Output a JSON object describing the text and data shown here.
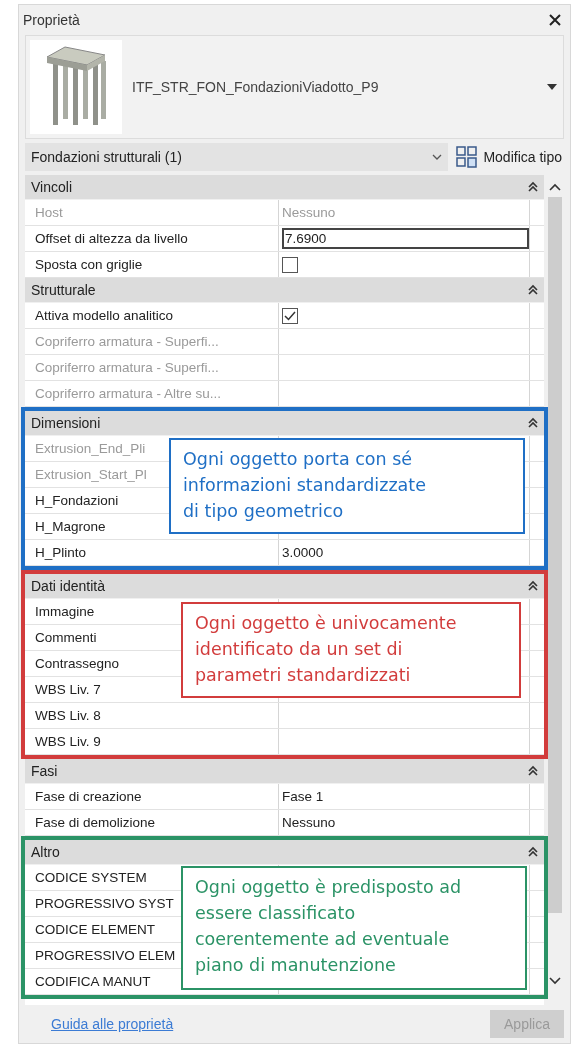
{
  "panel": {
    "title": "Proprietà"
  },
  "type_selector": {
    "name": "ITF_STR_FON_FondazioniViadotto_P9"
  },
  "filter": {
    "value": "Fondazioni strutturali (1)",
    "edit_type_button": "Modifica tipo"
  },
  "sections": [
    {
      "title": "Vincoli",
      "rows": [
        {
          "label": "Host",
          "kind": "text",
          "value": "Nessuno",
          "disabled": true
        },
        {
          "label": "Offset di altezza da livello",
          "kind": "edit",
          "value": "7.6900",
          "disabled": false
        },
        {
          "label": "Sposta con griglie",
          "kind": "checkbox",
          "checked": false,
          "disabled": false
        }
      ]
    },
    {
      "title": "Strutturale",
      "rows": [
        {
          "label": "Attiva modello analitico",
          "kind": "checkbox",
          "checked": true,
          "disabled": false
        },
        {
          "label": "Copriferro armatura - Superfi...",
          "kind": "text",
          "disabled": true
        },
        {
          "label": "Copriferro armatura - Superfi...",
          "kind": "text",
          "disabled": true
        },
        {
          "label": "Copriferro armatura - Altre su...",
          "kind": "text",
          "disabled": true
        }
      ]
    },
    {
      "title": "Dimensioni",
      "annotation": {
        "text": "Ogni oggetto porta con sé\ninformazioni standardizzate\ndi tipo geometrico",
        "color": "#1f6fc5"
      },
      "rows": [
        {
          "label": "Extrusion_End_Pli",
          "kind": "text",
          "disabled": true
        },
        {
          "label": "Extrusion_Start_Pl",
          "kind": "text",
          "disabled": true
        },
        {
          "label": "H_Fondazioni",
          "kind": "text",
          "disabled": false
        },
        {
          "label": "H_Magrone",
          "kind": "text",
          "disabled": false
        },
        {
          "label": "H_Plinto",
          "kind": "text",
          "value": "3.0000",
          "disabled": false
        }
      ]
    },
    {
      "title": "Dati identità",
      "annotation": {
        "text": "Ogni oggetto è univocamente\nidentificato da un set di\nparametri standardizzati",
        "color": "#d23c3c"
      },
      "rows": [
        {
          "label": "Immagine",
          "kind": "text",
          "disabled": false
        },
        {
          "label": "Commenti",
          "kind": "text",
          "disabled": false
        },
        {
          "label": "Contrassegno",
          "kind": "text",
          "disabled": false
        },
        {
          "label": "WBS Liv. 7",
          "kind": "text",
          "disabled": false
        },
        {
          "label": "WBS Liv. 8",
          "kind": "text",
          "disabled": false
        },
        {
          "label": "WBS Liv. 9",
          "kind": "text",
          "disabled": false
        }
      ]
    },
    {
      "title": "Fasi",
      "rows": [
        {
          "label": "Fase di creazione",
          "kind": "text",
          "value": "Fase 1",
          "disabled": false
        },
        {
          "label": "Fase di demolizione",
          "kind": "text",
          "value": "Nessuno",
          "disabled": false
        }
      ]
    },
    {
      "title": "Altro",
      "annotation": {
        "text": "Ogni oggetto è predisposto ad\nessere classificato\ncoerentemente ad eventuale\npiano di manutenzione",
        "color": "#2b9366"
      },
      "rows": [
        {
          "label": "CODICE SYSTEM",
          "kind": "text",
          "disabled": false
        },
        {
          "label": "PROGRESSIVO SYST",
          "kind": "text",
          "disabled": false
        },
        {
          "label": "CODICE ELEMENT",
          "kind": "text",
          "disabled": false
        },
        {
          "label": "PROGRESSIVO ELEM",
          "kind": "text",
          "disabled": false
        },
        {
          "label": "CODIFICA MANUT",
          "kind": "text",
          "disabled": false
        }
      ]
    }
  ],
  "footer": {
    "help_link": "Guida alle proprietà",
    "apply_button": {
      "label": "Applica",
      "disabled": true
    }
  }
}
